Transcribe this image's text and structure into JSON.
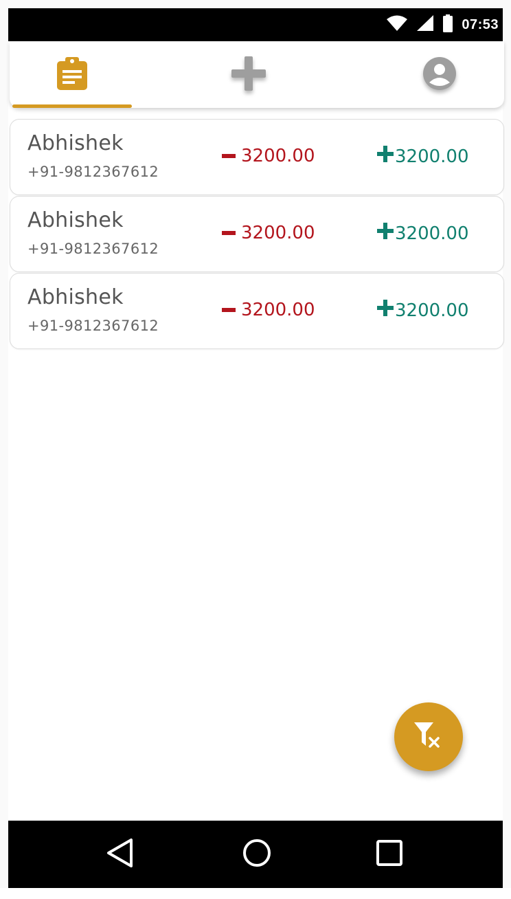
{
  "status_bar": {
    "time": "07:53",
    "icons": [
      "wifi-icon",
      "signal-icon",
      "battery-icon"
    ]
  },
  "tabs": [
    {
      "name": "entries",
      "icon": "clipboard-icon",
      "selected": true
    },
    {
      "name": "add",
      "icon": "plus-icon",
      "selected": false
    },
    {
      "name": "profile",
      "icon": "account-circle-icon",
      "selected": false
    }
  ],
  "entries": [
    {
      "name": "Abhishek",
      "phone": "+91-9812367612",
      "debit": "3200.00",
      "credit": "3200.00"
    },
    {
      "name": "Abhishek",
      "phone": "+91-9812367612",
      "debit": "3200.00",
      "credit": "3200.00"
    },
    {
      "name": "Abhishek",
      "phone": "+91-9812367612",
      "debit": "3200.00",
      "credit": "3200.00"
    }
  ],
  "fab": {
    "icon": "filter-clear-icon"
  },
  "nav_bar": {
    "icons": [
      "back-icon",
      "home-icon",
      "recents-icon"
    ]
  },
  "colors": {
    "accent": "#d59a22",
    "debit": "#b3151d",
    "credit": "#11806f",
    "inactive_icon": "#9e9e9e"
  }
}
